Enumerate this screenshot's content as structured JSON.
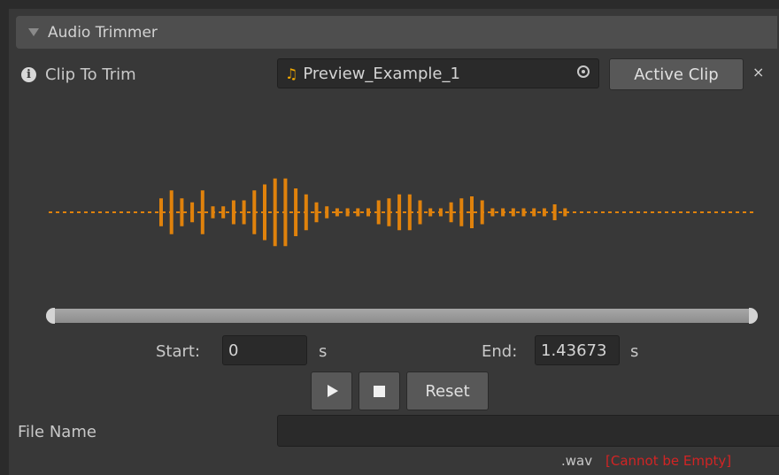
{
  "panel": {
    "title": "Audio Trimmer"
  },
  "clip": {
    "label": "Clip To Trim",
    "value": "Preview_Example_1",
    "active_button": "Active Clip",
    "close": "×"
  },
  "waveform": {
    "color": "#e0820c",
    "bar_levels": [
      0.35,
      0.55,
      0.35,
      0.25,
      0.55,
      0.15,
      0.15,
      0.3,
      0.3,
      0.55,
      0.7,
      0.85,
      0.85,
      0.6,
      0.45,
      0.25,
      0.15,
      0.1,
      0.1,
      0.1,
      0.1,
      0.3,
      0.35,
      0.45,
      0.45,
      0.3,
      0.1,
      0.1,
      0.25,
      0.35,
      0.4,
      0.3,
      0.1,
      0.1,
      0.1,
      0.1,
      0.1,
      0.1,
      0.2,
      0.1
    ]
  },
  "trim": {
    "start_label": "Start:",
    "start_value": "0",
    "start_unit": "s",
    "end_label": "End:",
    "end_value": "1.43673",
    "end_unit": "s"
  },
  "controls": {
    "play_icon": "play-icon",
    "stop_icon": "stop-icon",
    "reset_label": "Reset"
  },
  "file": {
    "label": "File Name",
    "value": "",
    "extension": ".wav",
    "error": "[Cannot be Empty]",
    "error_color": "#d22424"
  }
}
